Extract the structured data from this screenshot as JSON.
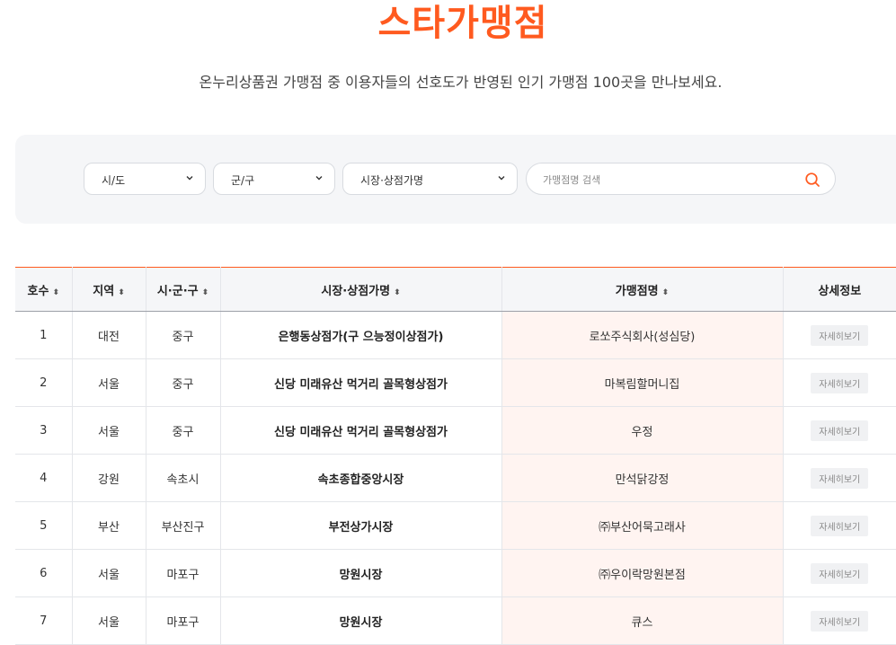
{
  "page": {
    "title": "스타가맹점",
    "subtitle": "온누리상품권 가맹점 중 이용자들의 선호도가 반영된 인기 가맹점 100곳을 만나보세요."
  },
  "filters": {
    "sido": "시/도",
    "gungu": "군/구",
    "market": "시장·상점가명",
    "search_placeholder": "가맹점명 검색"
  },
  "table": {
    "columns": [
      "호수",
      "지역",
      "시·군·구",
      "시장·상점가명",
      "가맹점명",
      "상세정보"
    ],
    "detail_label": "자세히보기",
    "rows": [
      {
        "no": "1",
        "region": "대전",
        "district": "중구",
        "market": "은행동상점가(구 으능정이상점가)",
        "store": "로쏘주식회사(성심당)"
      },
      {
        "no": "2",
        "region": "서울",
        "district": "중구",
        "market": "신당 미래유산 먹거리 골목형상점가",
        "store": "마복림할머니집"
      },
      {
        "no": "3",
        "region": "서울",
        "district": "중구",
        "market": "신당 미래유산 먹거리 골목형상점가",
        "store": "우정"
      },
      {
        "no": "4",
        "region": "강원",
        "district": "속초시",
        "market": "속초종합중앙시장",
        "store": "만석닭강정"
      },
      {
        "no": "5",
        "region": "부산",
        "district": "부산진구",
        "market": "부전상가시장",
        "store": "㈜부산어묵고래사"
      },
      {
        "no": "6",
        "region": "서울",
        "district": "마포구",
        "market": "망원시장",
        "store": "㈜우이락망원본점"
      },
      {
        "no": "7",
        "region": "서울",
        "district": "마포구",
        "market": "망원시장",
        "store": "큐스"
      }
    ]
  },
  "colors": {
    "accent": "#ff5a1f",
    "panel": "#f5f6f8",
    "store_cell": "#fff4f1"
  },
  "icons": {
    "select": "chevron-down-icon",
    "search": "search-icon",
    "sort": "sort-icon"
  }
}
